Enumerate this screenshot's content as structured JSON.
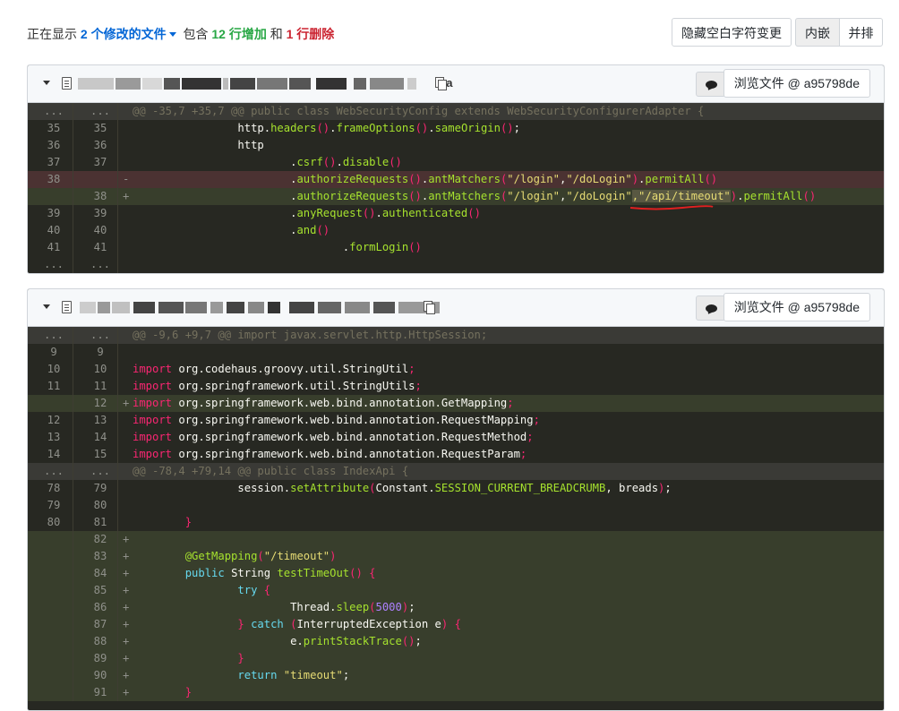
{
  "summary": {
    "prefix": "正在显示",
    "files_changed": "2 个修改的文件",
    "middle": "包含",
    "additions": "12 行增加",
    "and": "和",
    "deletions": "1 行删除"
  },
  "toolbar": {
    "hide_whitespace": "隐藏空白字符变更",
    "inline": "内嵌",
    "side_by_side": "并排"
  },
  "files": [
    {
      "ext_visible": "va",
      "view_file": "浏览文件 @ a95798de",
      "lines": [
        {
          "type": "ctx",
          "o": "...",
          "n": "...",
          "text": "@@ -35,7 +35,7 @@ public class WebSecurityConfig extends WebSecurityConfigurerAdapter {"
        },
        {
          "type": "normal",
          "o": "35",
          "n": "35",
          "html": [
            [
              "pl",
              "                http."
            ],
            [
              "fn",
              "headers"
            ],
            [
              "kw",
              "()"
            ],
            [
              "pl",
              "."
            ],
            [
              "fn",
              "frameOptions"
            ],
            [
              "kw",
              "()"
            ],
            [
              "pl",
              "."
            ],
            [
              "fn",
              "sameOrigin"
            ],
            [
              "kw",
              "()"
            ],
            [
              "pl",
              ";"
            ]
          ]
        },
        {
          "type": "normal",
          "o": "36",
          "n": "36",
          "html": [
            [
              "pl",
              "                http"
            ]
          ]
        },
        {
          "type": "normal",
          "o": "37",
          "n": "37",
          "html": [
            [
              "pl",
              "                        ."
            ],
            [
              "fn",
              "csrf"
            ],
            [
              "kw",
              "()"
            ],
            [
              "pl",
              "."
            ],
            [
              "fn",
              "disable"
            ],
            [
              "kw",
              "()"
            ]
          ]
        },
        {
          "type": "del",
          "o": "38",
          "n": "",
          "mk": "-",
          "html": [
            [
              "pl",
              "                        ."
            ],
            [
              "fn",
              "authorizeRequests"
            ],
            [
              "kw",
              "()"
            ],
            [
              "pl",
              "."
            ],
            [
              "fn",
              "antMatchers"
            ],
            [
              "kw",
              "("
            ],
            [
              "str",
              "\"/login\""
            ],
            [
              "pl",
              ","
            ],
            [
              "str",
              "\"/doLogin\""
            ],
            [
              "kw",
              ")"
            ],
            [
              "pl",
              "."
            ],
            [
              "fn",
              "permitAll"
            ],
            [
              "kw",
              "()"
            ]
          ]
        },
        {
          "type": "add",
          "o": "",
          "n": "38",
          "mk": "+",
          "html": [
            [
              "pl",
              "                        ."
            ],
            [
              "fn",
              "authorizeRequests"
            ],
            [
              "kw",
              "()"
            ],
            [
              "pl",
              "."
            ],
            [
              "fn",
              "antMatchers"
            ],
            [
              "kw",
              "("
            ],
            [
              "str",
              "\"/login\""
            ],
            [
              "pl",
              ","
            ],
            [
              "str",
              "\"/doLogin\""
            ],
            [
              "hl",
              ",\"/api/timeout\""
            ],
            [
              "kw",
              ")"
            ],
            [
              "pl",
              "."
            ],
            [
              "fn",
              "permitAll"
            ],
            [
              "kw",
              "()"
            ]
          ]
        },
        {
          "type": "normal",
          "o": "39",
          "n": "39",
          "html": [
            [
              "pl",
              "                        ."
            ],
            [
              "fn",
              "anyRequest"
            ],
            [
              "kw",
              "()"
            ],
            [
              "pl",
              "."
            ],
            [
              "fn",
              "authenticated"
            ],
            [
              "kw",
              "()"
            ]
          ]
        },
        {
          "type": "normal",
          "o": "40",
          "n": "40",
          "html": [
            [
              "pl",
              "                        ."
            ],
            [
              "fn",
              "and"
            ],
            [
              "kw",
              "()"
            ]
          ]
        },
        {
          "type": "normal",
          "o": "41",
          "n": "41",
          "html": [
            [
              "pl",
              "                                ."
            ],
            [
              "fn",
              "formLogin"
            ],
            [
              "kw",
              "()"
            ]
          ]
        },
        {
          "type": "normal",
          "o": "...",
          "n": "...",
          "html": []
        }
      ]
    },
    {
      "ext_visible": "",
      "view_file": "浏览文件 @ a95798de",
      "lines": [
        {
          "type": "ctx",
          "o": "...",
          "n": "...",
          "text": "@@ -9,6 +9,7 @@ import javax.servlet.http.HttpSession;"
        },
        {
          "type": "normal",
          "o": "9",
          "n": "9",
          "html": []
        },
        {
          "type": "normal",
          "o": "10",
          "n": "10",
          "html": [
            [
              "kw",
              "import"
            ],
            [
              "pl",
              " org.codehaus.groovy.util.StringUtil"
            ],
            [
              "kw",
              ";"
            ]
          ]
        },
        {
          "type": "normal",
          "o": "11",
          "n": "11",
          "html": [
            [
              "kw",
              "import"
            ],
            [
              "pl",
              " org.springframework.util.StringUtils"
            ],
            [
              "kw",
              ";"
            ]
          ]
        },
        {
          "type": "add",
          "o": "",
          "n": "12",
          "mk": "+",
          "html": [
            [
              "kw",
              "import"
            ],
            [
              "pl",
              " org.springframework.web.bind.annotation.GetMapping"
            ],
            [
              "kw",
              ";"
            ]
          ]
        },
        {
          "type": "normal",
          "o": "12",
          "n": "13",
          "html": [
            [
              "kw",
              "import"
            ],
            [
              "pl",
              " org.springframework.web.bind.annotation.RequestMapping"
            ],
            [
              "kw",
              ";"
            ]
          ]
        },
        {
          "type": "normal",
          "o": "13",
          "n": "14",
          "html": [
            [
              "kw",
              "import"
            ],
            [
              "pl",
              " org.springframework.web.bind.annotation.RequestMethod"
            ],
            [
              "kw",
              ";"
            ]
          ]
        },
        {
          "type": "normal",
          "o": "14",
          "n": "15",
          "html": [
            [
              "kw",
              "import"
            ],
            [
              "pl",
              " org.springframework.web.bind.annotation.RequestParam"
            ],
            [
              "kw",
              ";"
            ]
          ]
        },
        {
          "type": "ctx",
          "o": "...",
          "n": "...",
          "text": "@@ -78,4 +79,14 @@ public class IndexApi {"
        },
        {
          "type": "normal",
          "o": "78",
          "n": "79",
          "html": [
            [
              "pl",
              "                session."
            ],
            [
              "fn",
              "setAttribute"
            ],
            [
              "kw",
              "("
            ],
            [
              "pl",
              "Constant."
            ],
            [
              "fn",
              "SESSION_CURRENT_BREADCRUMB"
            ],
            [
              "pl",
              ", breads"
            ],
            [
              "kw",
              ")"
            ],
            [
              "pl",
              ";"
            ]
          ]
        },
        {
          "type": "normal",
          "o": "79",
          "n": "80",
          "html": []
        },
        {
          "type": "normal",
          "o": "80",
          "n": "81",
          "html": [
            [
              "kw",
              "        }"
            ]
          ]
        },
        {
          "type": "add",
          "o": "",
          "n": "82",
          "mk": "+",
          "html": []
        },
        {
          "type": "add",
          "o": "",
          "n": "83",
          "mk": "+",
          "html": [
            [
              "ann",
              "        @GetMapping"
            ],
            [
              "kw",
              "("
            ],
            [
              "str",
              "\"/timeout\""
            ],
            [
              "kw",
              ")"
            ]
          ]
        },
        {
          "type": "add",
          "o": "",
          "n": "84",
          "mk": "+",
          "html": [
            [
              "kw2",
              "        public"
            ],
            [
              "pl",
              " String "
            ],
            [
              "fn",
              "testTimeOut"
            ],
            [
              "kw",
              "()"
            ],
            [
              "kw",
              " {"
            ]
          ]
        },
        {
          "type": "add",
          "o": "",
          "n": "85",
          "mk": "+",
          "html": [
            [
              "kw2",
              "                try"
            ],
            [
              "kw",
              " {"
            ]
          ]
        },
        {
          "type": "add",
          "o": "",
          "n": "86",
          "mk": "+",
          "html": [
            [
              "pl",
              "                        Thread."
            ],
            [
              "fn",
              "sleep"
            ],
            [
              "kw",
              "("
            ],
            [
              "num",
              "5000"
            ],
            [
              "kw",
              ")"
            ],
            [
              "pl",
              ";"
            ]
          ]
        },
        {
          "type": "add",
          "o": "",
          "n": "87",
          "mk": "+",
          "html": [
            [
              "kw",
              "                }"
            ],
            [
              "kw2",
              " catch"
            ],
            [
              "kw",
              " ("
            ],
            [
              "pl",
              "InterruptedException e"
            ],
            [
              "kw",
              ")"
            ],
            [
              "kw",
              " {"
            ]
          ]
        },
        {
          "type": "add",
          "o": "",
          "n": "88",
          "mk": "+",
          "html": [
            [
              "pl",
              "                        e."
            ],
            [
              "fn",
              "printStackTrace"
            ],
            [
              "kw",
              "()"
            ],
            [
              "pl",
              ";"
            ]
          ]
        },
        {
          "type": "add",
          "o": "",
          "n": "89",
          "mk": "+",
          "html": [
            [
              "kw",
              "                }"
            ]
          ]
        },
        {
          "type": "add",
          "o": "",
          "n": "90",
          "mk": "+",
          "html": [
            [
              "kw2",
              "                return"
            ],
            [
              "str",
              " \"timeout\""
            ],
            [
              "pl",
              ";"
            ]
          ]
        },
        {
          "type": "add",
          "o": "",
          "n": "91",
          "mk": "+",
          "html": [
            [
              "kw",
              "        }"
            ]
          ]
        }
      ]
    }
  ]
}
